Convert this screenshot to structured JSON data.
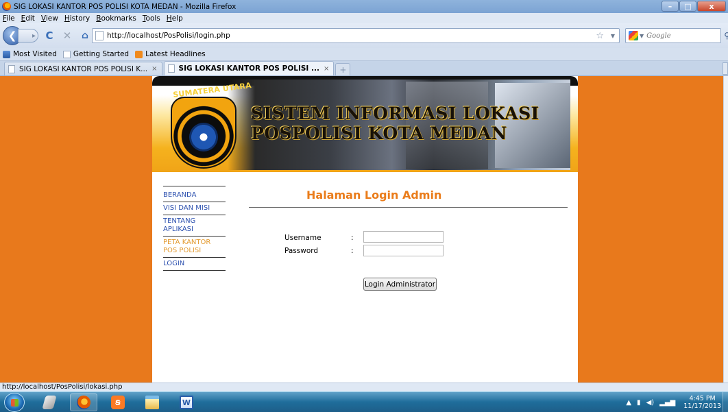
{
  "window": {
    "title": "SIG LOKASI KANTOR POS POLISI KOTA MEDAN - Mozilla Firefox",
    "controls": {
      "minimize": "–",
      "maximize": "□",
      "close": "x"
    }
  },
  "menu": [
    "File",
    "Edit",
    "View",
    "History",
    "Bookmarks",
    "Tools",
    "Help"
  ],
  "navigation": {
    "back_glyph": "❮",
    "forward_glyph": "▸",
    "reload_glyph": "C",
    "stop_glyph": "✕",
    "home_glyph": "⌂",
    "url": "http://localhost/PosPolisi/login.php",
    "search_placeholder": "Google"
  },
  "bookmarks": [
    "Most Visited",
    "Getting Started",
    "Latest Headlines"
  ],
  "tabs": [
    {
      "label": "SIG LOKASI KANTOR POS POLISI K...",
      "active": false
    },
    {
      "label": "SIG LOKASI KANTOR POS POLISI ...",
      "active": true
    }
  ],
  "banner": {
    "badge_text": "SUMATERA UTARA",
    "headline_line1": "SISTEM INFORMASI LOKASI",
    "headline_line2": "POSPOLISI KOTA MEDAN"
  },
  "sidebar": {
    "items": [
      {
        "label": "BERANDA"
      },
      {
        "label": "VISI DAN MISI"
      },
      {
        "label": "TENTANG APLIKASI"
      },
      {
        "label": "PETA KANTOR POS POLISI"
      },
      {
        "label": "LOGIN"
      }
    ]
  },
  "login": {
    "title": "Halaman Login Admin",
    "username_label": "Username",
    "password_label": "Password",
    "colon": ":",
    "username_value": "",
    "password_value": "",
    "submit_label": "Login Administrator"
  },
  "status_bar": "http://localhost/PosPolisi/lokasi.php",
  "taskbar": {
    "clock_time": "4:45 PM",
    "clock_date": "11/17/2013"
  },
  "colors": {
    "page_background": "#e8791c",
    "link_blue": "#2b4fae",
    "title_orange": "#ea7c1a"
  }
}
